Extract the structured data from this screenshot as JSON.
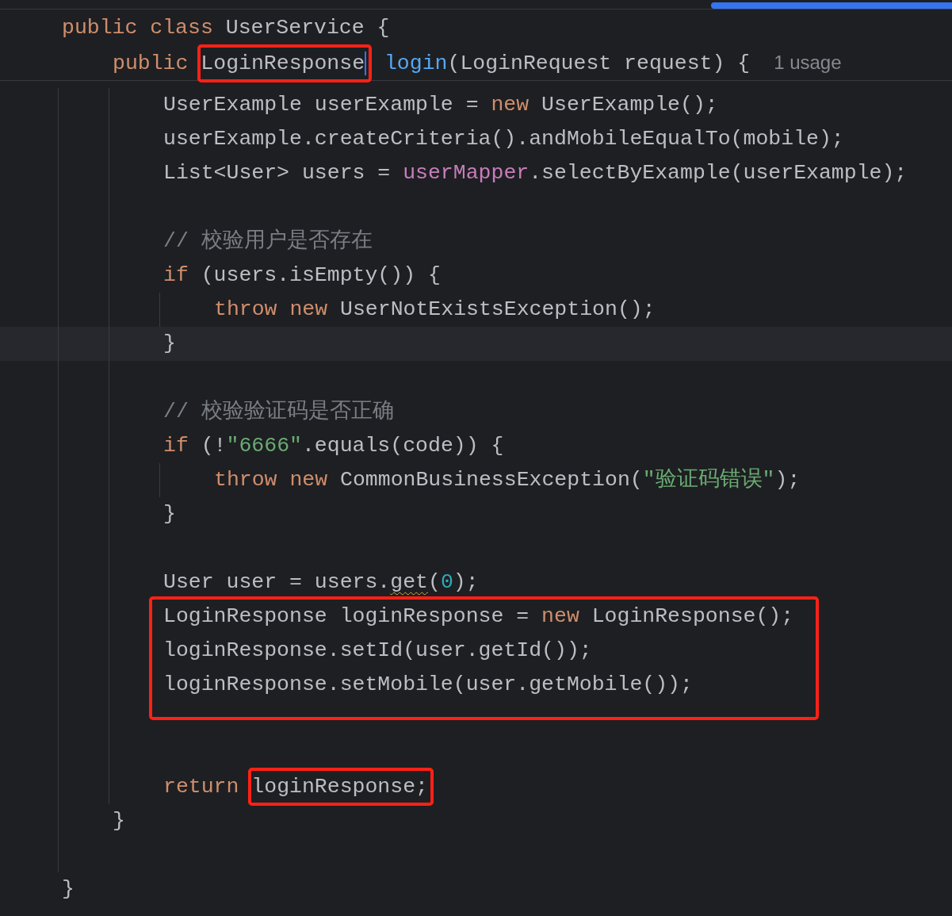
{
  "sticky_header": [
    {
      "kind": "line",
      "tokens": [
        {
          "kind": "keyword",
          "text": "public class "
        },
        {
          "kind": "plain",
          "text": "UserService {"
        }
      ]
    },
    {
      "kind": "block",
      "children": [
        {
          "kind": "line",
          "tokens": [
            {
              "kind": "keyword",
              "text": "public "
            },
            {
              "kind": "plain",
              "text": "LoginResponse",
              "boxed": true,
              "caret": true
            },
            {
              "kind": "method",
              "text": " login"
            },
            {
              "kind": "plain",
              "text": "(LoginRequest request) {"
            },
            {
              "kind": "hint",
              "text": "1 usage"
            }
          ]
        }
      ]
    }
  ],
  "code": [
    {
      "kind": "block",
      "children": [
        {
          "kind": "block",
          "children": [
            {
              "kind": "line",
              "tokens": [
                {
                  "kind": "plain",
                  "text": "UserExample userExample = "
                },
                {
                  "kind": "keyword",
                  "text": "new"
                },
                {
                  "kind": "plain",
                  "text": " UserExample();"
                }
              ]
            },
            {
              "kind": "line",
              "tokens": [
                {
                  "kind": "plain",
                  "text": "userExample.createCriteria().andMobileEqualTo(mobile);"
                }
              ]
            },
            {
              "kind": "line",
              "tokens": [
                {
                  "kind": "plain",
                  "text": "List<User> users = "
                },
                {
                  "kind": "field",
                  "text": "userMapper"
                },
                {
                  "kind": "plain",
                  "text": ".selectByExample(userExample);"
                }
              ]
            },
            {
              "kind": "blank"
            },
            {
              "kind": "line",
              "tokens": [
                {
                  "kind": "comment",
                  "text": "// 校验用户是否存在"
                }
              ]
            },
            {
              "kind": "line",
              "tokens": [
                {
                  "kind": "keyword",
                  "text": "if"
                },
                {
                  "kind": "plain",
                  "text": " (users.isEmpty()) {"
                }
              ]
            },
            {
              "kind": "block",
              "children": [
                {
                  "kind": "line",
                  "tokens": [
                    {
                      "kind": "keyword",
                      "text": "throw new"
                    },
                    {
                      "kind": "plain",
                      "text": " UserNotExistsException();"
                    }
                  ]
                }
              ]
            },
            {
              "kind": "line",
              "current": true,
              "tokens": [
                {
                  "kind": "plain",
                  "text": "}"
                }
              ]
            },
            {
              "kind": "blank"
            },
            {
              "kind": "line",
              "tokens": [
                {
                  "kind": "comment",
                  "text": "// 校验验证码是否正确"
                }
              ]
            },
            {
              "kind": "line",
              "tokens": [
                {
                  "kind": "keyword",
                  "text": "if"
                },
                {
                  "kind": "plain",
                  "text": " (!"
                },
                {
                  "kind": "string",
                  "text": "\"6666\""
                },
                {
                  "kind": "plain",
                  "text": ".equals(code)) {"
                }
              ]
            },
            {
              "kind": "block",
              "children": [
                {
                  "kind": "line",
                  "tokens": [
                    {
                      "kind": "keyword",
                      "text": "throw new"
                    },
                    {
                      "kind": "plain",
                      "text": " CommonBusinessException("
                    },
                    {
                      "kind": "string",
                      "text": "\"验证码错误\""
                    },
                    {
                      "kind": "plain",
                      "text": ");"
                    }
                  ]
                }
              ]
            },
            {
              "kind": "line",
              "tokens": [
                {
                  "kind": "plain",
                  "text": "}"
                }
              ]
            },
            {
              "kind": "blank"
            },
            {
              "kind": "line",
              "tokens": [
                {
                  "kind": "plain",
                  "text": "User user = users."
                },
                {
                  "kind": "plain",
                  "text": "get",
                  "warning": true
                },
                {
                  "kind": "plain",
                  "text": "("
                },
                {
                  "kind": "number",
                  "text": "0"
                },
                {
                  "kind": "plain",
                  "text": ");"
                }
              ]
            },
            {
              "kind": "highlight",
              "children": [
                {
                  "kind": "line",
                  "tokens": [
                    {
                      "kind": "plain",
                      "text": "LoginResponse loginResponse = "
                    },
                    {
                      "kind": "keyword",
                      "text": "new"
                    },
                    {
                      "kind": "plain",
                      "text": " LoginResponse();"
                    }
                  ]
                },
                {
                  "kind": "line",
                  "tokens": [
                    {
                      "kind": "plain",
                      "text": "loginResponse.setId(user.getId());"
                    }
                  ]
                },
                {
                  "kind": "line",
                  "tokens": [
                    {
                      "kind": "plain",
                      "text": "loginResponse.setMobile(user.getMobile());"
                    }
                  ]
                }
              ]
            },
            {
              "kind": "blank"
            },
            {
              "kind": "blank"
            },
            {
              "kind": "line",
              "tokens": [
                {
                  "kind": "keyword",
                  "text": "return "
                },
                {
                  "kind": "plain",
                  "text": "loginResponse;",
                  "boxed": true
                }
              ]
            }
          ]
        },
        {
          "kind": "line",
          "tokens": [
            {
              "kind": "plain",
              "text": "}"
            }
          ]
        },
        {
          "kind": "blank"
        }
      ]
    },
    {
      "kind": "line",
      "tokens": [
        {
          "kind": "plain",
          "text": "}"
        }
      ]
    }
  ]
}
